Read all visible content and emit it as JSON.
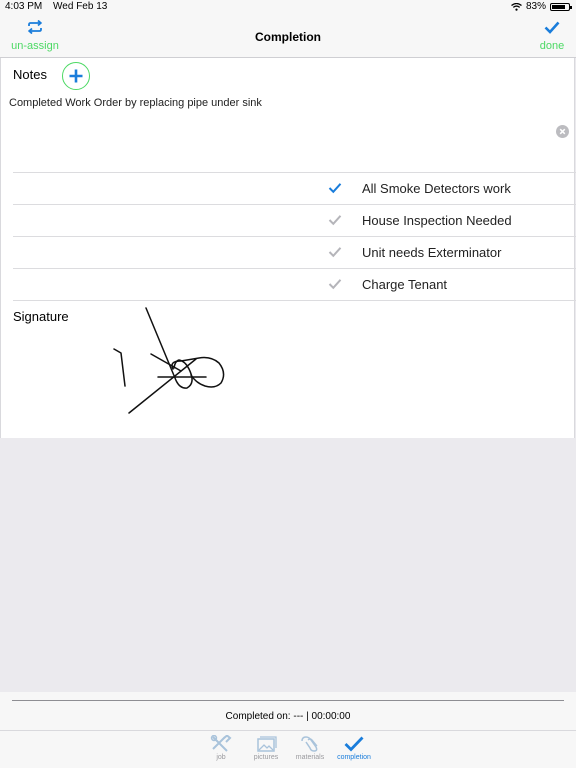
{
  "status_bar": {
    "time": "4:03 PM",
    "date": "Wed Feb 13",
    "battery": "83%",
    "battery_level": 0.83
  },
  "navbar": {
    "title": "Completion",
    "left_label": "un-assign",
    "left_icon": "repeat-icon",
    "right_label": "done",
    "right_icon": "checkmark-icon"
  },
  "notes": {
    "label": "Notes",
    "text": "Completed Work Order by replacing pipe under sink"
  },
  "checklist": [
    {
      "label": "All Smoke Detectors work",
      "checked": true
    },
    {
      "label": "House Inspection Needed",
      "checked": false
    },
    {
      "label": "Unit needs Exterminator",
      "checked": false
    },
    {
      "label": "Charge Tenant",
      "checked": false
    }
  ],
  "signature": {
    "label": "Signature"
  },
  "footer": {
    "completed_on": "Completed on: --- | 00:00:00"
  },
  "tabs": [
    {
      "label": "job",
      "icon": "tools-icon",
      "active": false
    },
    {
      "label": "pictures",
      "icon": "photos-icon",
      "active": false
    },
    {
      "label": "materials",
      "icon": "paperclip-icon",
      "active": false
    },
    {
      "label": "completion",
      "icon": "checkmark-icon",
      "active": true
    }
  ],
  "colors": {
    "accent_green": "#4cd964",
    "accent_blue": "#1a7ddb",
    "checked_blue": "#1a7ddb",
    "unchecked_gray": "#b5b5ba"
  }
}
